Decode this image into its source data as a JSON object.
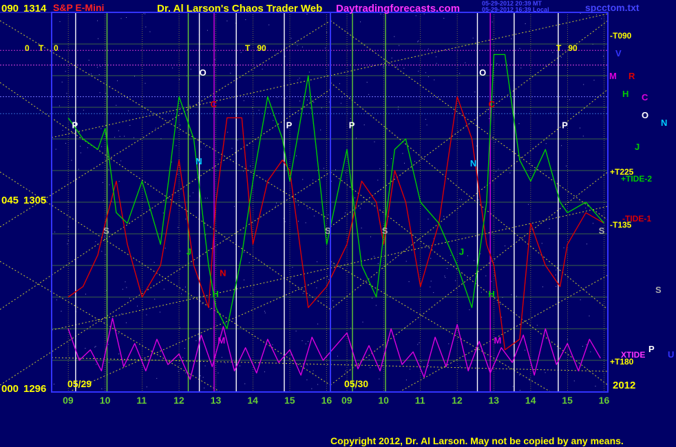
{
  "header": {
    "title_left": "S&P E-Mini",
    "title_center": "Dr. Al Larson's Chaos Trader Web",
    "site": "Daytradingforecasts.com",
    "stamp_line1": "05-29-2012 20:39 MT",
    "stamp_line2": "05-29-2012 16:39 Local",
    "filename": "spcctom.txt"
  },
  "left_labels": {
    "price_top": "1314",
    "price_mid": "1305",
    "price_bottom": "1296",
    "angle_top": "090",
    "angle_mid": "045",
    "angle_bottom": "000",
    "zero_0": "0",
    "zero_T": "T"
  },
  "session_labels": {
    "day1_start": "0",
    "day1_T90": "T   90",
    "day2_T90": "T   90"
  },
  "right_labels": {
    "t090": "-T090",
    "t225": "+T225",
    "t135": "-T135",
    "t180": "+T180",
    "tide2": "+TIDE-2",
    "tide1": "-TIDE-1",
    "xtide": "XTIDE",
    "year": "2012",
    "planet_V": "V",
    "planet_M": "M",
    "planet_R": "R",
    "planet_H": "H",
    "planet_C": "C",
    "planet_O": "O",
    "planet_N": "N",
    "planet_J": "J",
    "planet_S": "S",
    "planet_P": "P",
    "planet_U": "U"
  },
  "date_labels": {
    "d1": "05/29",
    "d2": "05/30"
  },
  "footer": {
    "copyright": "Copyright 2012, Dr. Al Larson. May not be copied by any means."
  },
  "colors": {
    "background": "#000066",
    "price": "#00cc00",
    "tide1": "#dd0000",
    "xtide": "#dd00dd",
    "grid": "#66aa33",
    "gann_lines": "#cccc33",
    "frame": "#3333ff",
    "day_divider": "#3333ff"
  },
  "chart_data": {
    "type": "line",
    "title": "S&P E-Mini",
    "ylim": [
      1296,
      1314
    ],
    "yticks": [
      1296,
      1305,
      1314
    ],
    "days": [
      {
        "date": "05/29",
        "hours": [
          "09",
          "10",
          "11",
          "12",
          "13",
          "14",
          "15",
          "16"
        ]
      },
      {
        "date": "05/30",
        "hours": [
          "09",
          "10",
          "11",
          "12",
          "13",
          "14",
          "15",
          "16"
        ]
      }
    ],
    "series": [
      {
        "name": "",
        "color": "#00cc00",
        "x": [
          9,
          9.4,
          9.8,
          10,
          10.3,
          10.6,
          11,
          11.5,
          12,
          12.4,
          12.8,
          13,
          13.3,
          13.7,
          14,
          14.4,
          14.8,
          15,
          15.5,
          16,
          17,
          17.4,
          17.8,
          18,
          18.3,
          18.6,
          19,
          19.5,
          20,
          20.4,
          20.8,
          21,
          21.3,
          21.7,
          22,
          22.4,
          22.8,
          23,
          23.5,
          24
        ],
        "y": [
          1309,
          1308,
          1307.5,
          1308.5,
          1304.5,
          1304,
          1306,
          1303,
          1310,
          1308,
          1302,
          1300,
          1299,
          1302.5,
          1306,
          1310,
          1308,
          1306,
          1311,
          1303,
          1307.5,
          1302,
          1300.5,
          1303.5,
          1307.5,
          1308,
          1305,
          1304,
          1302,
          1300,
          1305,
          1312,
          1312,
          1307,
          1306,
          1307.5,
          1305,
          1304.5,
          1305,
          1304
        ]
      },
      {
        "name": "TIDE-1",
        "color": "#dd0000",
        "x": [
          9,
          9.4,
          9.8,
          10,
          10.3,
          10.6,
          11,
          11.5,
          12,
          12.4,
          12.8,
          13,
          13.3,
          13.7,
          14,
          14.4,
          14.8,
          15,
          15.5,
          16,
          17,
          17.4,
          17.8,
          18,
          18.3,
          18.6,
          19,
          19.5,
          20,
          20.4,
          20.8,
          21,
          21.3,
          21.7,
          22,
          22.4,
          22.8,
          23,
          23.5,
          24
        ],
        "y": [
          1300.5,
          1301,
          1302.5,
          1304,
          1306,
          1303,
          1300.5,
          1302,
          1307,
          1302,
          1300,
          1305,
          1309,
          1309,
          1303,
          1306,
          1307,
          1306.5,
          1300,
          1301,
          1303,
          1306,
          1305,
          1303,
          1306.5,
          1305,
          1301,
          1304,
          1310,
          1308,
          1303,
          1302,
          1298,
          1298.5,
          1304,
          1302,
          1301,
          1303,
          1304.5,
          1304
        ]
      }
    ],
    "xtide": {
      "name": "XTIDE",
      "color": "#dd00dd",
      "x": [
        9,
        9.3,
        9.6,
        9.9,
        10.2,
        10.5,
        10.8,
        11.1,
        11.4,
        11.7,
        12,
        12.3,
        12.6,
        12.9,
        13.2,
        13.5,
        13.8,
        14.1,
        14.4,
        14.7,
        15,
        15.3,
        15.6,
        15.9,
        17,
        17.3,
        17.6,
        17.9,
        18.2,
        18.5,
        18.8,
        19.1,
        19.4,
        19.7,
        20,
        20.3,
        20.6,
        20.9,
        21.2,
        21.5,
        21.8,
        22.1,
        22.4,
        22.7,
        23,
        23.3,
        23.6,
        23.9
      ],
      "y": [
        1299,
        1297.5,
        1298,
        1297,
        1299.5,
        1297.2,
        1298.3,
        1297,
        1298.5,
        1297.3,
        1297.8,
        1296.6,
        1298.7,
        1297.2,
        1299.1,
        1297,
        1298.1,
        1296.9,
        1298.5,
        1297.4,
        1298,
        1296.8,
        1298.6,
        1297.5,
        1298.8,
        1297.1,
        1298.2,
        1297,
        1299,
        1297.3,
        1297.9,
        1296.7,
        1298.6,
        1297.2,
        1299.2,
        1297,
        1298.4,
        1296.9,
        1298.1,
        1297.4,
        1298.7,
        1296.8,
        1299,
        1297.3,
        1298.3,
        1297,
        1298.5,
        1297.6
      ]
    },
    "planet_time_lines": [
      {
        "x": 9.2,
        "color": "#ffffff"
      },
      {
        "x": 10.05,
        "color": "#66cc33"
      },
      {
        "x": 12.25,
        "color": "#66cc33"
      },
      {
        "x": 12.55,
        "color": "#ffffff"
      },
      {
        "x": 12.95,
        "color": "#dd00dd"
      },
      {
        "x": 13.55,
        "color": "#ffffff"
      },
      {
        "x": 14.85,
        "color": "#ffffff"
      },
      {
        "x": 17.15,
        "color": "#66cc33"
      },
      {
        "x": 18.05,
        "color": "#66cc33"
      },
      {
        "x": 20.55,
        "color": "#ffffff"
      },
      {
        "x": 20.9,
        "color": "#dd00dd"
      },
      {
        "x": 21.55,
        "color": "#ffffff"
      },
      {
        "x": 22.75,
        "color": "#ffffff"
      }
    ],
    "chart_markers": [
      {
        "label": "P",
        "x": 9.1,
        "y": 1308.5,
        "color": "#ffffff"
      },
      {
        "label": "S",
        "x": 9.95,
        "y": 1303.5,
        "color": "#aaaaaa"
      },
      {
        "label": "O",
        "x": 12.55,
        "y": 1311,
        "color": "#ffffff"
      },
      {
        "label": "C",
        "x": 12.85,
        "y": 1309.5,
        "color": "#dd0000"
      },
      {
        "label": "N",
        "x": 12.45,
        "y": 1306.8,
        "color": "#00ccff"
      },
      {
        "label": "J",
        "x": 12.2,
        "y": 1302.5,
        "color": "#00cc00"
      },
      {
        "label": "N",
        "x": 13.1,
        "y": 1301.5,
        "color": "#dd0000"
      },
      {
        "label": "H",
        "x": 12.9,
        "y": 1300.5,
        "color": "#00cc00"
      },
      {
        "label": "M",
        "x": 13.05,
        "y": 1298.3,
        "color": "#dd00dd"
      },
      {
        "label": "P",
        "x": 14.9,
        "y": 1308.5,
        "color": "#ffffff"
      },
      {
        "label": "S",
        "x": 15.95,
        "y": 1303.5,
        "color": "#aaaaaa"
      },
      {
        "label": "P",
        "x": 17.05,
        "y": 1308.5,
        "color": "#ffffff"
      },
      {
        "label": "S",
        "x": 17.95,
        "y": 1303.5,
        "color": "#aaaaaa"
      },
      {
        "label": "O",
        "x": 20.6,
        "y": 1311,
        "color": "#ffffff"
      },
      {
        "label": "C",
        "x": 20.85,
        "y": 1309.5,
        "color": "#dd0000"
      },
      {
        "label": "N",
        "x": 20.35,
        "y": 1306.7,
        "color": "#00ccff"
      },
      {
        "label": "J",
        "x": 20.05,
        "y": 1302.5,
        "color": "#00cc00"
      },
      {
        "label": "H",
        "x": 20.85,
        "y": 1300.5,
        "color": "#00cc00"
      },
      {
        "label": "M",
        "x": 21.0,
        "y": 1298.3,
        "color": "#dd00dd"
      },
      {
        "label": "P",
        "x": 22.85,
        "y": 1308.5,
        "color": "#ffffff"
      },
      {
        "label": "S",
        "x": 23.85,
        "y": 1303.5,
        "color": "#aaaaaa"
      }
    ]
  }
}
